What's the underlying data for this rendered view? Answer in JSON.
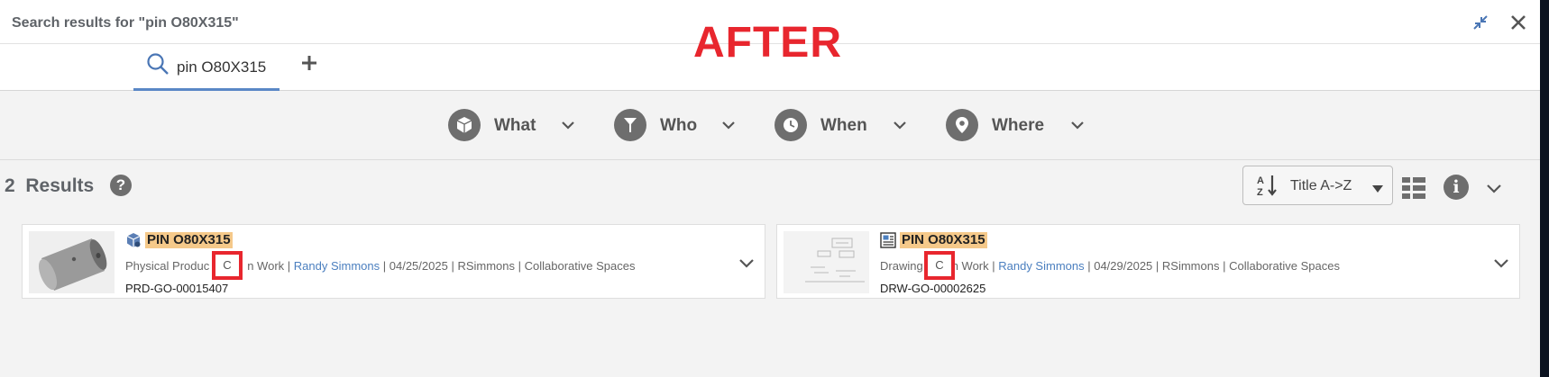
{
  "header": {
    "title": "Search results for \"pin O80X315\"",
    "overlay_label": "AFTER"
  },
  "tabs": {
    "search_tab_label": "pin O80X315"
  },
  "filters": [
    {
      "label": "What",
      "icon": "cube-icon"
    },
    {
      "label": "Who",
      "icon": "person-icon"
    },
    {
      "label": "When",
      "icon": "clock-icon"
    },
    {
      "label": "Where",
      "icon": "location-pin-icon"
    }
  ],
  "results": {
    "count": "2",
    "label": "Results",
    "help_glyph": "?",
    "info_glyph": "i",
    "sort_label": "Title A->Z"
  },
  "cards": [
    {
      "title": "PIN O80X315",
      "type": "Physical Produc",
      "revision": "C",
      "status": "n Work",
      "owner": "Randy Simmons",
      "date": "04/25/2025",
      "user": "RSimmons",
      "space": "Collaborative Spaces",
      "id": "PRD-GO-00015407",
      "type_icon": "physical-product-icon"
    },
    {
      "title": "PIN O80X315",
      "type": "Drawing",
      "revision": "C",
      "status": "n Work",
      "owner": "Randy Simmons",
      "date": "04/29/2025",
      "user": "RSimmons",
      "space": "Collaborative Spaces",
      "id": "DRW-GO-00002625",
      "type_icon": "drawing-icon"
    }
  ],
  "colors": {
    "accent": "#5a87c6",
    "highlight": "#f5c98a",
    "annotation_red": "#e8262e",
    "link": "#4b7fbf"
  }
}
